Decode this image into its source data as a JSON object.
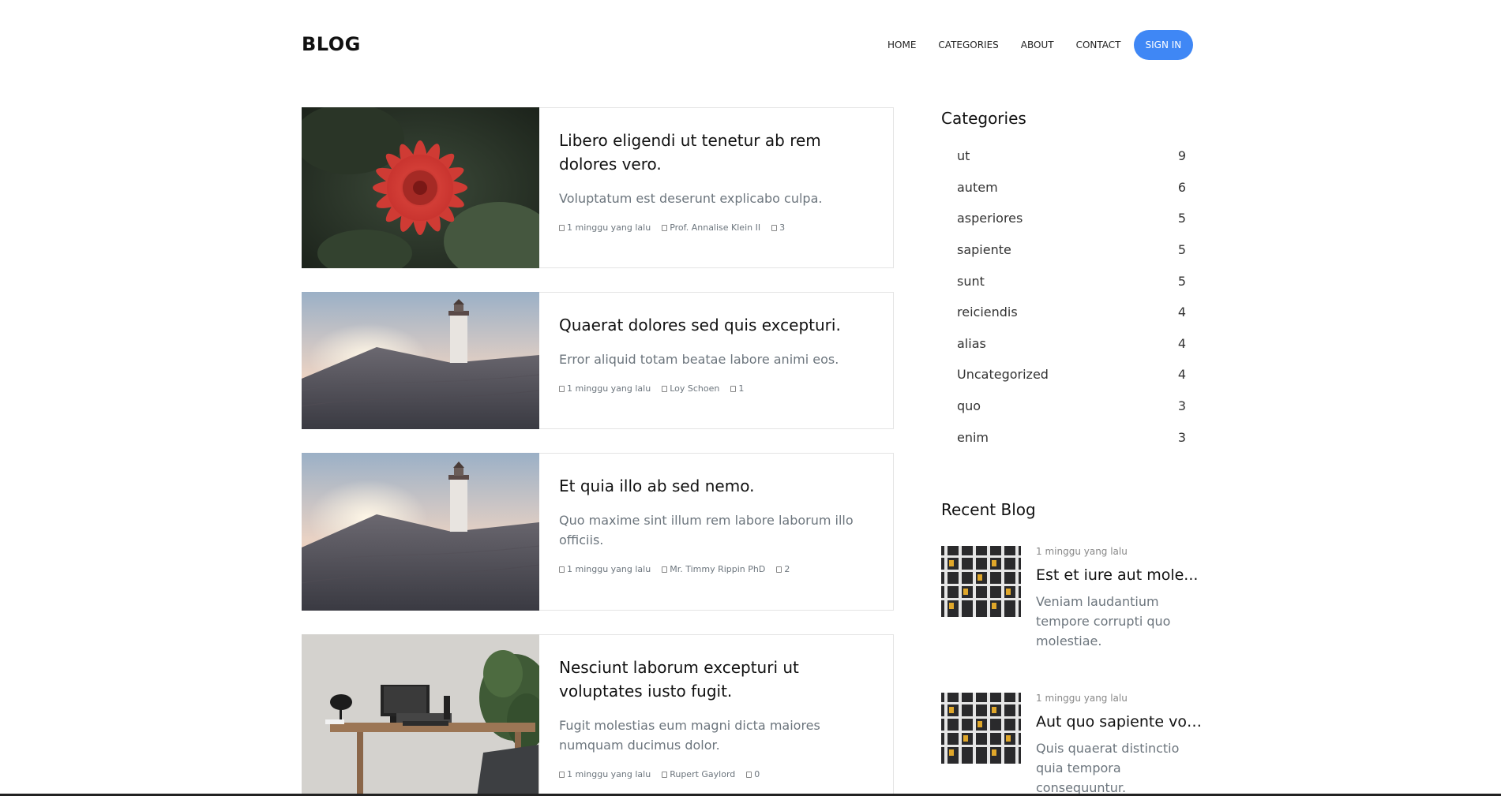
{
  "brand": "BLOG",
  "nav": {
    "home": "HOME",
    "categories": "CATEGORIES",
    "about": "ABOUT",
    "contact": "CONTACT",
    "signin": "SIGN IN"
  },
  "colors": {
    "accent": "#3f87f5"
  },
  "posts": [
    {
      "title": "Libero eligendi ut tenetur ab rem dolores vero.",
      "excerpt": "Voluptatum est deserunt explicabo culpa.",
      "date": "1 minggu yang lalu",
      "author": "Prof. Annalise Klein II",
      "comments": "3",
      "image": "red-dahlia-flower"
    },
    {
      "title": "Quaerat dolores sed quis excepturi.",
      "excerpt": "Error aliquid totam beatae labore animi eos.",
      "date": "1 minggu yang lalu",
      "author": "Loy Schoen",
      "comments": "1",
      "image": "lighthouse-on-dunes"
    },
    {
      "title": "Et quia illo ab sed nemo.",
      "excerpt": "Quo maxime sint illum rem labore laborum illo officiis.",
      "date": "1 minggu yang lalu",
      "author": "Mr. Timmy Rippin PhD",
      "comments": "2",
      "image": "lighthouse-on-dunes"
    },
    {
      "title": "Nesciunt laborum excepturi ut voluptates iusto fugit.",
      "excerpt": "Fugit molestias eum magni dicta maiores numquam ducimus dolor.",
      "date": "1 minggu yang lalu",
      "author": "Rupert Gaylord",
      "comments": "0",
      "image": "desk-workspace"
    }
  ],
  "sidebar": {
    "categories_heading": "Categories",
    "categories": [
      {
        "name": "ut",
        "count": "9"
      },
      {
        "name": "autem",
        "count": "6"
      },
      {
        "name": "asperiores",
        "count": "5"
      },
      {
        "name": "sapiente",
        "count": "5"
      },
      {
        "name": "sunt",
        "count": "5"
      },
      {
        "name": "reiciendis",
        "count": "4"
      },
      {
        "name": "alias",
        "count": "4"
      },
      {
        "name": "Uncategorized",
        "count": "4"
      },
      {
        "name": "quo",
        "count": "3"
      },
      {
        "name": "enim",
        "count": "3"
      }
    ],
    "recent_heading": "Recent Blog",
    "recent": [
      {
        "date": "1 minggu yang lalu",
        "title": "Est et iure aut mole...",
        "excerpt": "Veniam laudantium tempore corrupti quo molestiae.",
        "image": "building-facade"
      },
      {
        "date": "1 minggu yang lalu",
        "title": "Aut quo sapiente vol...",
        "excerpt": "Quis quaerat distinctio quia tempora consequuntur.",
        "image": "building-facade"
      }
    ]
  }
}
